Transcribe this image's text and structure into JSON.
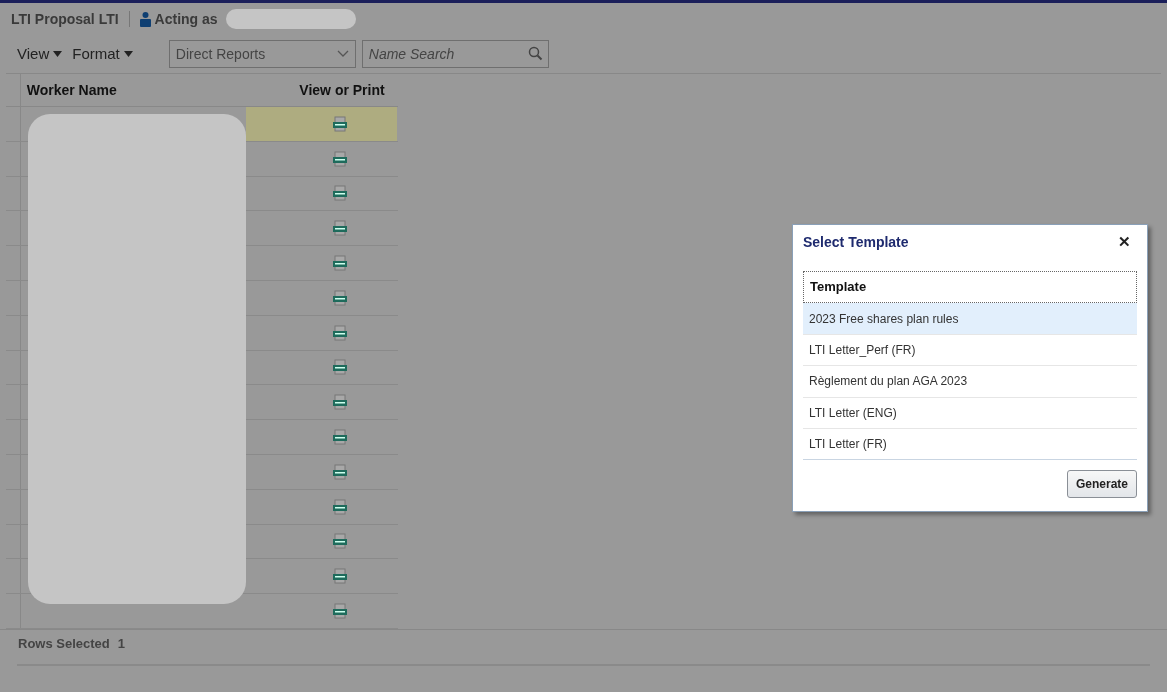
{
  "header": {
    "title": "LTI Proposal LTI",
    "acting_as": "Acting as"
  },
  "toolbar": {
    "menus": [
      "View",
      "Format"
    ],
    "filter": {
      "value": "Direct Reports"
    },
    "search": {
      "placeholder": "Name Search"
    }
  },
  "table": {
    "columns": [
      "Worker Name",
      "View or Print"
    ],
    "rows": [
      {
        "selected": true
      },
      {
        "selected": false
      },
      {
        "selected": false
      },
      {
        "selected": false
      },
      {
        "selected": false
      },
      {
        "selected": false
      },
      {
        "selected": false
      },
      {
        "selected": false
      },
      {
        "selected": false
      },
      {
        "selected": false
      },
      {
        "selected": false
      },
      {
        "selected": false
      },
      {
        "selected": false
      },
      {
        "selected": false
      },
      {
        "selected": false
      }
    ]
  },
  "footer": {
    "label": "Rows Selected",
    "count": "1"
  },
  "dialog": {
    "title": "Select Template",
    "close": "✕",
    "column": "Template",
    "templates": [
      {
        "name": "2023 Free shares plan rules",
        "selected": true
      },
      {
        "name": "LTI Letter_Perf (FR)",
        "selected": false
      },
      {
        "name": "Règlement du plan AGA 2023",
        "selected": false
      },
      {
        "name": "LTI Letter (ENG)",
        "selected": false
      },
      {
        "name": "LTI Letter (FR)",
        "selected": false
      }
    ],
    "button": "Generate"
  }
}
